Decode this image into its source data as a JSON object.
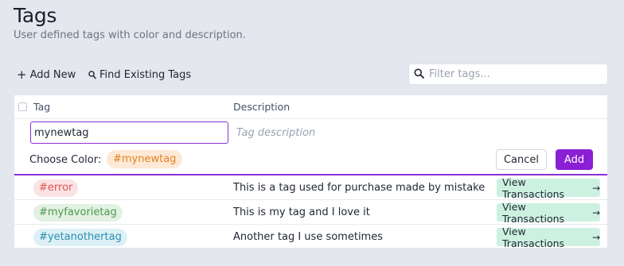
{
  "page": {
    "title": "Tags",
    "subtitle": "User defined tags with color and description."
  },
  "toolbar": {
    "add_new_label": "Add New",
    "find_existing_label": "Find Existing Tags",
    "filter_placeholder": "Filter tags..."
  },
  "table": {
    "columns": {
      "tag": "Tag",
      "description": "Description"
    }
  },
  "new_tag_form": {
    "name_value": "mynewtag",
    "description_placeholder": "Tag description",
    "choose_color_label": "Choose Color:",
    "color_preview": "#mynewtag",
    "cancel_label": "Cancel",
    "add_label": "Add"
  },
  "rows": [
    {
      "tag": "#error",
      "description": "This is a tag used for purchase made by mistake",
      "action": "View Transactions",
      "pill_bg": "#fbe3e3",
      "pill_fg": "#e05555"
    },
    {
      "tag": "#myfavorietag",
      "description": "This is my tag and I love it",
      "action": "View Transactions",
      "pill_bg": "#e2f1e2",
      "pill_fg": "#4b9a4b"
    },
    {
      "tag": "#yetanothertag",
      "description": "Another tag I use sometimes",
      "action": "View Transactions",
      "pill_bg": "#dcf0f6",
      "pill_fg": "#2b8fb0"
    }
  ],
  "colors": {
    "accent": "#8a1fd6",
    "action_bg": "#cdf1e0",
    "color_preview_bg": "#fde9d6",
    "color_preview_fg": "#e3821f"
  }
}
